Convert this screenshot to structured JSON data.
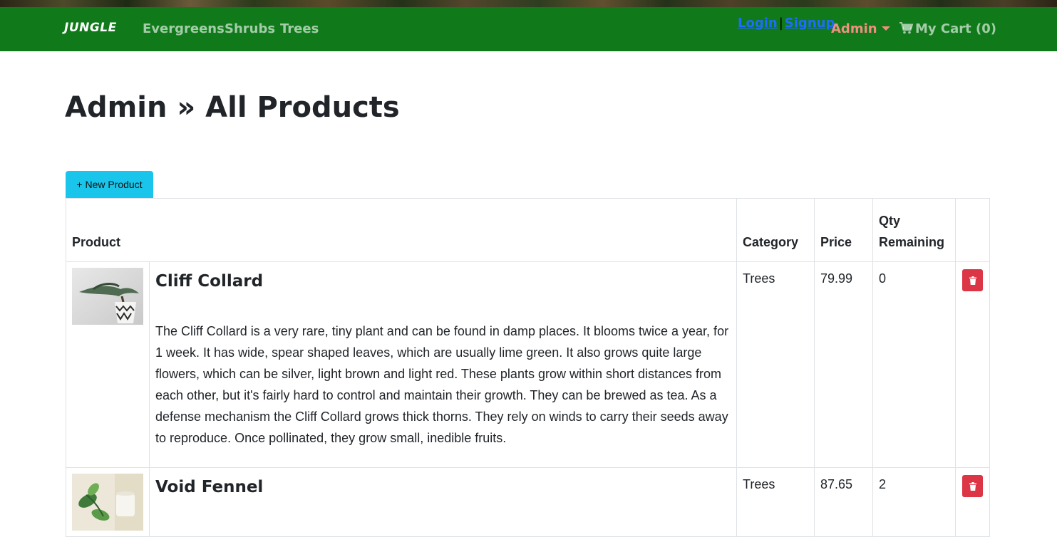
{
  "navbar": {
    "brand": "JUNGLE",
    "links": [
      "Evergreens",
      "Shrubs",
      "Trees"
    ],
    "login": "Login",
    "separator": "|",
    "signup": "Signup",
    "admin": "Admin",
    "cart": "My Cart (0)",
    "cart_icon": "shopping-cart-icon",
    "colors": {
      "navbar_bg": "#107a1b",
      "admin": "#f08f80",
      "auth_link": "#1e6cff"
    }
  },
  "page": {
    "title": "Admin » All Products",
    "new_product_button": "+ New Product",
    "button_color": "#19c5ea"
  },
  "table": {
    "headers": {
      "product": "Product",
      "category": "Category",
      "price": "Price",
      "qty": "Qty Remaining"
    },
    "delete_icon": "trash-icon",
    "delete_color": "#dc3545",
    "rows": [
      {
        "name": "Cliff Collard",
        "description": "The Cliff Collard is a very rare, tiny plant and can be found in damp places. It blooms twice a year, for 1 week. It has wide, spear shaped leaves, which are usually lime green. It also grows quite large flowers, which can be silver, light brown and light red. These plants grow within short distances from each other, but it's fairly hard to control and maintain their growth. They can be brewed as tea. As a defense mechanism the Cliff Collard grows thick thorns. They rely on winds to carry their seeds away to reproduce. Once pollinated, they grow small, inedible fruits.",
        "category": "Trees",
        "price": "79.99",
        "qty": "0",
        "image": "bonsai-in-patterned-pot"
      },
      {
        "name": "Void Fennel",
        "description": "",
        "category": "Trees",
        "price": "87.65",
        "qty": "2",
        "image": "vine-plant-in-white-pot"
      }
    ]
  }
}
